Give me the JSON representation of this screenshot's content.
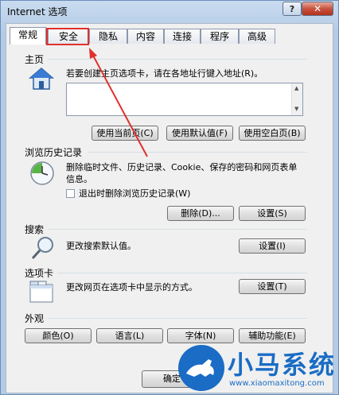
{
  "window": {
    "title": "Internet 选项",
    "help": "?",
    "close": "✕"
  },
  "tabs": [
    "常规",
    "安全",
    "隐私",
    "内容",
    "连接",
    "程序",
    "高级"
  ],
  "home": {
    "section": "主页",
    "desc": "若要创建主页选项卡，请在各地址行键入地址(R)。",
    "buttons": [
      "使用当前页(C)",
      "使用默认值(F)",
      "使用空白页(B)"
    ]
  },
  "history": {
    "section": "浏览历史记录",
    "desc": "删除临时文件、历史记录、Cookie、保存的密码和网页表单信息。",
    "checkbox": "退出时删除浏览历史记录(W)",
    "delete_btn": "删除(D)...",
    "settings_btn": "设置(S)"
  },
  "search": {
    "section": "搜索",
    "desc": "更改搜索默认值。",
    "settings_btn": "设置(I)"
  },
  "tabs_section": {
    "section": "选项卡",
    "desc": "更改网页在选项卡中显示的方式。",
    "settings_btn": "设置(T)"
  },
  "appearance": {
    "section": "外观",
    "buttons": [
      "颜色(O)",
      "语言(L)",
      "字体(N)",
      "辅助功能(E)"
    ]
  },
  "footer": {
    "ok": "确定"
  },
  "watermark": {
    "title": "小马系统",
    "url": "www.xiaomaxitong.com"
  },
  "colors": {
    "annotation": "#e0302c",
    "watermark": "#1a6cc4"
  }
}
